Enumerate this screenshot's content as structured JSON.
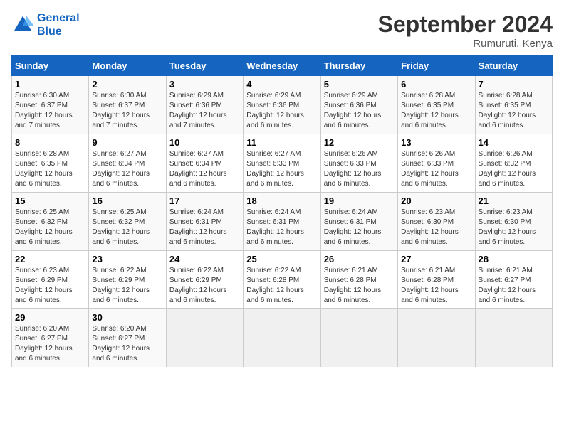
{
  "header": {
    "logo_line1": "General",
    "logo_line2": "Blue",
    "month": "September 2024",
    "location": "Rumuruti, Kenya"
  },
  "days_of_week": [
    "Sunday",
    "Monday",
    "Tuesday",
    "Wednesday",
    "Thursday",
    "Friday",
    "Saturday"
  ],
  "weeks": [
    [
      {
        "day": "1",
        "sunrise": "6:30 AM",
        "sunset": "6:37 PM",
        "daylight": "12 hours and 7 minutes."
      },
      {
        "day": "2",
        "sunrise": "6:30 AM",
        "sunset": "6:37 PM",
        "daylight": "12 hours and 7 minutes."
      },
      {
        "day": "3",
        "sunrise": "6:29 AM",
        "sunset": "6:36 PM",
        "daylight": "12 hours and 7 minutes."
      },
      {
        "day": "4",
        "sunrise": "6:29 AM",
        "sunset": "6:36 PM",
        "daylight": "12 hours and 6 minutes."
      },
      {
        "day": "5",
        "sunrise": "6:29 AM",
        "sunset": "6:36 PM",
        "daylight": "12 hours and 6 minutes."
      },
      {
        "day": "6",
        "sunrise": "6:28 AM",
        "sunset": "6:35 PM",
        "daylight": "12 hours and 6 minutes."
      },
      {
        "day": "7",
        "sunrise": "6:28 AM",
        "sunset": "6:35 PM",
        "daylight": "12 hours and 6 minutes."
      }
    ],
    [
      {
        "day": "8",
        "sunrise": "6:28 AM",
        "sunset": "6:35 PM",
        "daylight": "12 hours and 6 minutes."
      },
      {
        "day": "9",
        "sunrise": "6:27 AM",
        "sunset": "6:34 PM",
        "daylight": "12 hours and 6 minutes."
      },
      {
        "day": "10",
        "sunrise": "6:27 AM",
        "sunset": "6:34 PM",
        "daylight": "12 hours and 6 minutes."
      },
      {
        "day": "11",
        "sunrise": "6:27 AM",
        "sunset": "6:33 PM",
        "daylight": "12 hours and 6 minutes."
      },
      {
        "day": "12",
        "sunrise": "6:26 AM",
        "sunset": "6:33 PM",
        "daylight": "12 hours and 6 minutes."
      },
      {
        "day": "13",
        "sunrise": "6:26 AM",
        "sunset": "6:33 PM",
        "daylight": "12 hours and 6 minutes."
      },
      {
        "day": "14",
        "sunrise": "6:26 AM",
        "sunset": "6:32 PM",
        "daylight": "12 hours and 6 minutes."
      }
    ],
    [
      {
        "day": "15",
        "sunrise": "6:25 AM",
        "sunset": "6:32 PM",
        "daylight": "12 hours and 6 minutes."
      },
      {
        "day": "16",
        "sunrise": "6:25 AM",
        "sunset": "6:32 PM",
        "daylight": "12 hours and 6 minutes."
      },
      {
        "day": "17",
        "sunrise": "6:24 AM",
        "sunset": "6:31 PM",
        "daylight": "12 hours and 6 minutes."
      },
      {
        "day": "18",
        "sunrise": "6:24 AM",
        "sunset": "6:31 PM",
        "daylight": "12 hours and 6 minutes."
      },
      {
        "day": "19",
        "sunrise": "6:24 AM",
        "sunset": "6:31 PM",
        "daylight": "12 hours and 6 minutes."
      },
      {
        "day": "20",
        "sunrise": "6:23 AM",
        "sunset": "6:30 PM",
        "daylight": "12 hours and 6 minutes."
      },
      {
        "day": "21",
        "sunrise": "6:23 AM",
        "sunset": "6:30 PM",
        "daylight": "12 hours and 6 minutes."
      }
    ],
    [
      {
        "day": "22",
        "sunrise": "6:23 AM",
        "sunset": "6:29 PM",
        "daylight": "12 hours and 6 minutes."
      },
      {
        "day": "23",
        "sunrise": "6:22 AM",
        "sunset": "6:29 PM",
        "daylight": "12 hours and 6 minutes."
      },
      {
        "day": "24",
        "sunrise": "6:22 AM",
        "sunset": "6:29 PM",
        "daylight": "12 hours and 6 minutes."
      },
      {
        "day": "25",
        "sunrise": "6:22 AM",
        "sunset": "6:28 PM",
        "daylight": "12 hours and 6 minutes."
      },
      {
        "day": "26",
        "sunrise": "6:21 AM",
        "sunset": "6:28 PM",
        "daylight": "12 hours and 6 minutes."
      },
      {
        "day": "27",
        "sunrise": "6:21 AM",
        "sunset": "6:28 PM",
        "daylight": "12 hours and 6 minutes."
      },
      {
        "day": "28",
        "sunrise": "6:21 AM",
        "sunset": "6:27 PM",
        "daylight": "12 hours and 6 minutes."
      }
    ],
    [
      {
        "day": "29",
        "sunrise": "6:20 AM",
        "sunset": "6:27 PM",
        "daylight": "12 hours and 6 minutes."
      },
      {
        "day": "30",
        "sunrise": "6:20 AM",
        "sunset": "6:27 PM",
        "daylight": "12 hours and 6 minutes."
      },
      null,
      null,
      null,
      null,
      null
    ]
  ]
}
